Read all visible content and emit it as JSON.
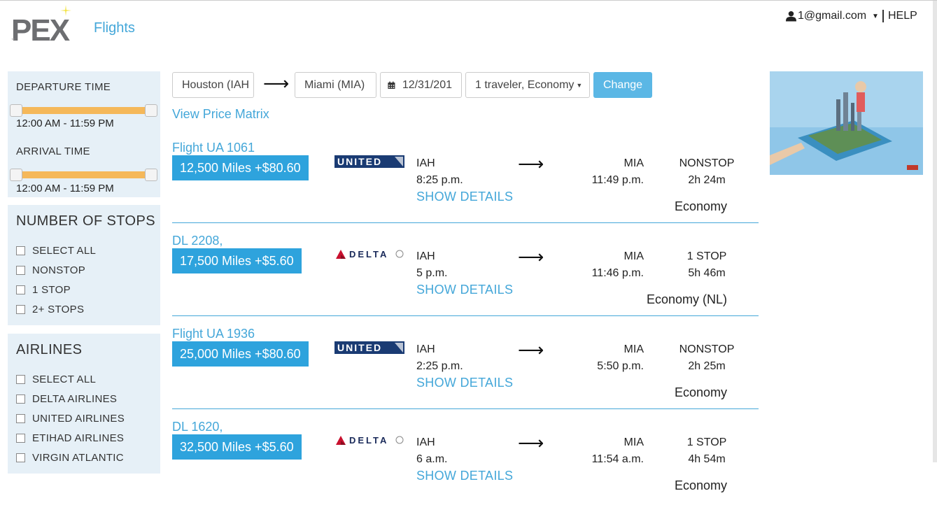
{
  "header": {
    "logo_text": "PEX",
    "logo_tm": "™",
    "nav_flights": "Flights",
    "user_email": "1@gmail.com",
    "help": "HELP"
  },
  "filters": {
    "departure_label": "DEPARTURE TIME",
    "departure_range": "12:00 AM - 11:59 PM",
    "arrival_label": "ARRIVAL TIME",
    "arrival_range": "12:00 AM - 11:59 PM",
    "stops_heading": "NUMBER OF STOPS",
    "stops": [
      "SELECT ALL",
      "NONSTOP",
      "1 STOP",
      "2+ STOPS"
    ],
    "airlines_heading": "AIRLINES",
    "airlines": [
      "SELECT ALL",
      "DELTA AIRLINES",
      "UNITED AIRLINES",
      "ETIHAD AIRLINES",
      "VIRGIN ATLANTIC"
    ]
  },
  "search": {
    "origin": "Houston (IAH",
    "destination": "Miami (MIA)",
    "date": "12/31/201",
    "travelers": "1 traveler, Economy",
    "change_button": "Change",
    "price_matrix": "View Price Matrix"
  },
  "flights": [
    {
      "name": "Flight UA 1061",
      "price": "12,500 Miles +$80.60",
      "airline": "UNITED",
      "from": "IAH",
      "dep": "8:25 p.m.",
      "details": "SHOW DETAILS",
      "to": "MIA",
      "arr": "11:49 p.m.",
      "stops": "NONSTOP",
      "duration": "2h 24m",
      "cabin": "Economy"
    },
    {
      "name": "DL 2208,",
      "price": "17,500 Miles +$5.60",
      "airline": "DELTA",
      "from": "IAH",
      "dep": "5 p.m.",
      "details": "SHOW DETAILS",
      "to": "MIA",
      "arr": "11:46 p.m.",
      "stops": "1 STOP",
      "duration": "5h 46m",
      "cabin": "Economy (NL)"
    },
    {
      "name": "Flight UA 1936",
      "price": "25,000 Miles +$80.60",
      "airline": "UNITED",
      "from": "IAH",
      "dep": "2:25 p.m.",
      "details": "SHOW DETAILS",
      "to": "MIA",
      "arr": "5:50 p.m.",
      "stops": "NONSTOP",
      "duration": "2h 25m",
      "cabin": "Economy"
    },
    {
      "name": "DL 1620,",
      "price": "32,500 Miles +$5.60",
      "airline": "DELTA",
      "from": "IAH",
      "dep": "6 a.m.",
      "details": "SHOW DETAILS",
      "to": "MIA",
      "arr": "11:54 a.m.",
      "stops": "1 STOP",
      "duration": "4h 54m",
      "cabin": "Economy"
    }
  ],
  "colors": {
    "accent": "#44a7d9",
    "button": "#2ea3dd",
    "slider": "#f5b85a",
    "panel": "#e6f0f7"
  }
}
